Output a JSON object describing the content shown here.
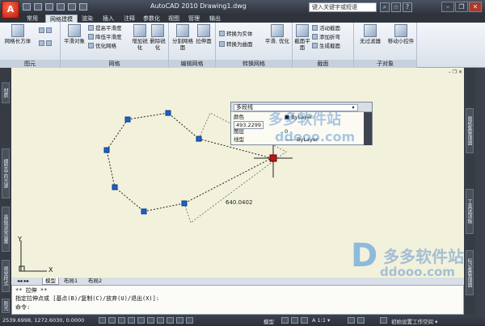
{
  "window": {
    "app_logo_letter": "A",
    "title": "AutoCAD 2010    Drawing1.dwg",
    "search_placeholder": "键入关键字或短语",
    "minimize": "–",
    "restore": "❐",
    "close": "✕",
    "help": "?",
    "star": "☆"
  },
  "tabs": [
    {
      "label": "常用",
      "active": false
    },
    {
      "label": "网格建模",
      "active": true
    },
    {
      "label": "渲染",
      "active": false
    },
    {
      "label": "插入",
      "active": false
    },
    {
      "label": "注释",
      "active": false
    },
    {
      "label": "参数化",
      "active": false
    },
    {
      "label": "视图",
      "active": false
    },
    {
      "label": "管理",
      "active": false
    },
    {
      "label": "输出",
      "active": false
    }
  ],
  "ribbon": {
    "panels": {
      "primitives": "图元",
      "mesh": "网格",
      "mesh_edit": "编辑网格",
      "convert": "转换网格",
      "section": "截面",
      "subobject": "子对象"
    },
    "buttons": {
      "mesh_box": "网格长方体",
      "smooth_object": "平滑对象",
      "raise_smooth": "提高平滑度",
      "lower_smooth": "降低平滑度",
      "refine_mesh": "优化网格",
      "add_crease": "增加锐化",
      "remove_crease": "删除锐化",
      "split_face": "分割网格面",
      "extrude_face": "拉伸面",
      "convert_solid": "转换为实体",
      "convert_surface": "转换为曲面",
      "smooth_optimized": "平滑, 优化",
      "section_plane": "截面平面",
      "live_section": "活动截面",
      "add_jog": "添加折弯",
      "generate_section": "生成截面",
      "no_filter": "无过滤器",
      "move_gizmo": "移动小控件"
    }
  },
  "side_tabs_left": [
    "材质",
    "模型中的光源",
    "高级渲染设置",
    "视觉样式",
    "阳光特性"
  ],
  "side_tabs_right": [
    "图纸集管理器",
    "工具选项板",
    "标记集管理器"
  ],
  "view_controls": "– ❐ ✕",
  "popup": {
    "type": "多段线",
    "rows": [
      {
        "label": "颜色",
        "value": "■ ByLayer"
      },
      {
        "label": "图层",
        "value": "0"
      },
      {
        "label": "线型",
        "value": "—— ByLayer"
      }
    ],
    "overlay_value": "493.2299"
  },
  "dimension_value": "640.0402",
  "ucs": {
    "y": "Y",
    "x": "X"
  },
  "layout_tabs": [
    {
      "label": "模型",
      "active": true
    },
    {
      "label": "布局1",
      "active": false
    },
    {
      "label": "布局2",
      "active": false
    }
  ],
  "command": {
    "line1": "** 拉伸 **",
    "line2": "指定拉伸点或 [基点(B)/复制(C)/放弃(U)/退出(X)]:",
    "prompt": "命令:"
  },
  "status": {
    "coords": "2539.6998, 1272.6030, 0.0000",
    "model": "模型",
    "scale": "A 1:1 ▾",
    "workspace": "初始设置工作空间 ▾"
  },
  "watermarks": {
    "brand": "多多软件站",
    "url": "ddooo.com"
  }
}
